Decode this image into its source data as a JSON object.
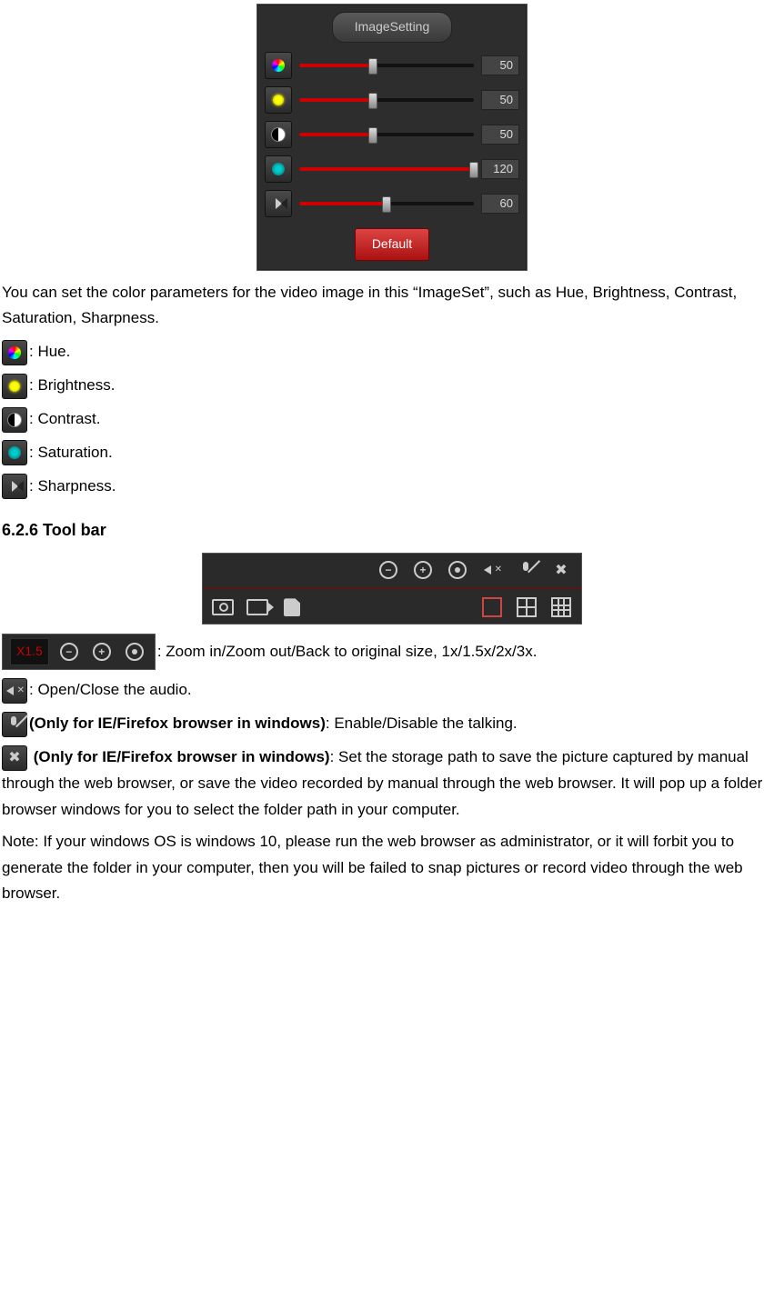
{
  "imageset": {
    "tab_label": "ImageSetting",
    "sliders": [
      {
        "icon": "hue-icon",
        "value": "50",
        "fill": 42
      },
      {
        "icon": "brightness-icon",
        "value": "50",
        "fill": 42
      },
      {
        "icon": "contrast-icon",
        "value": "50",
        "fill": 42
      },
      {
        "icon": "saturation-icon",
        "value": "120",
        "fill": 100
      },
      {
        "icon": "sharpness-icon",
        "value": "60",
        "fill": 50
      }
    ],
    "default_label": "Default"
  },
  "text": {
    "intro": "You can set the color parameters for the video image in this “ImageSet”, such as Hue, Brightness, Contrast, Saturation, Sharpness.",
    "hue": ": Hue.",
    "brightness": ": Brightness.",
    "contrast": ": Contrast.",
    "saturation": ": Saturation.",
    "sharpness": ": Sharpness.",
    "section_626": "6.2.6 Tool bar",
    "zoom_label": "X1.5",
    "zoom_desc": ": Zoom in/Zoom out/Back to original size, 1x/1.5x/2x/3x.",
    "audio_desc": ": Open/Close the audio.",
    "only_bold": "(Only for IE/Firefox browser in windows)",
    "talking_desc": ": Enable/Disable the talking.",
    "storage_desc": ": Set the storage path to save the picture captured by manual through the web browser, or save the video recorded by manual through the web browser. It will pop up a folder browser windows for you to select the folder path in your computer.",
    "note": "Note: If your windows OS is windows 10, please run the web browser as administrator, or it will forbit you to generate the folder in your computer, then you will be failed to snap pictures or record video through the web browser."
  },
  "chart_data": {
    "type": "table",
    "title": "ImageSetting sliders",
    "parameters": [
      "Hue",
      "Brightness",
      "Contrast",
      "Saturation",
      "Sharpness"
    ],
    "values": [
      50,
      50,
      50,
      120,
      60
    ]
  }
}
